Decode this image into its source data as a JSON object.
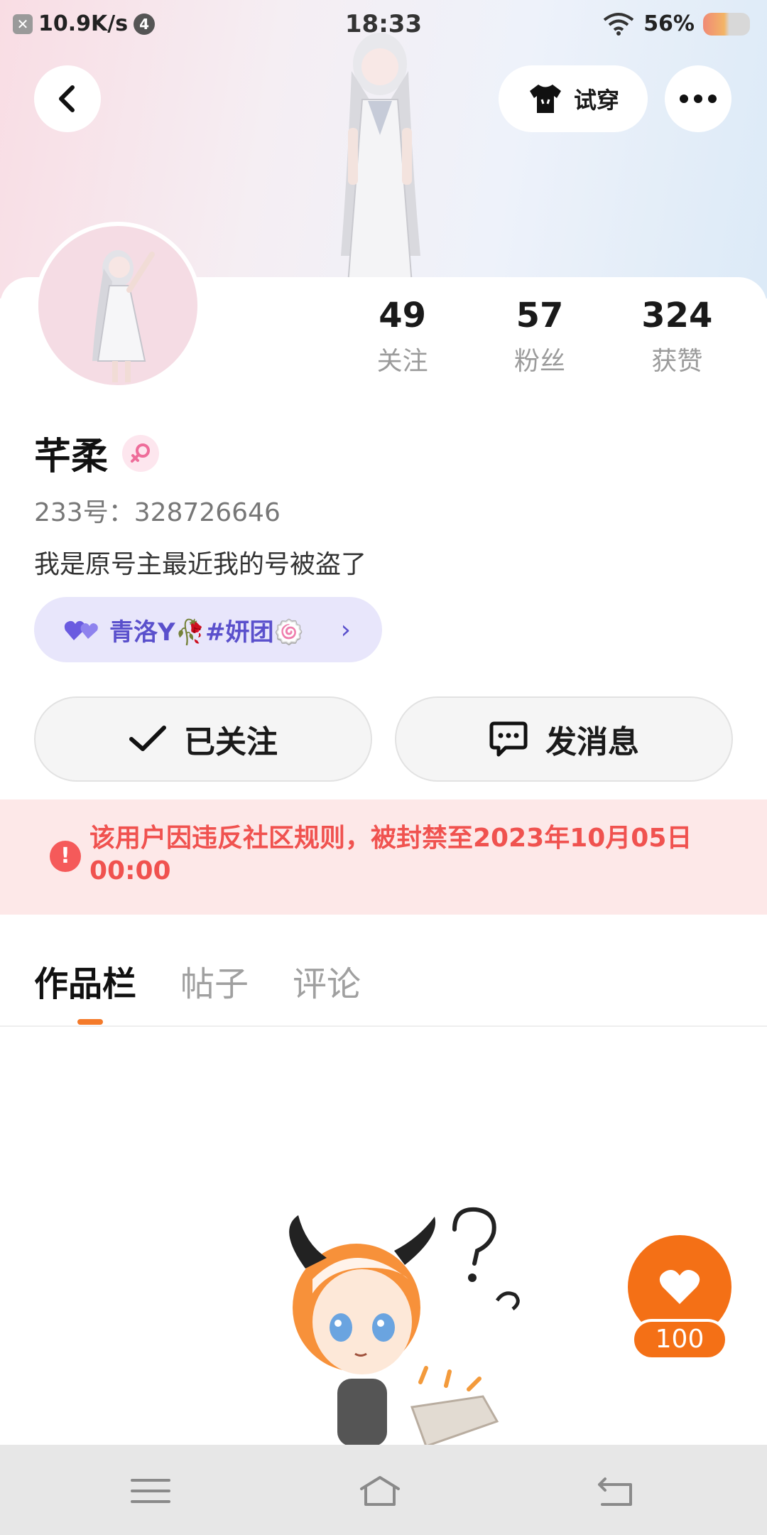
{
  "status_bar": {
    "speed": "10.9K/s",
    "badge": "4",
    "time": "18:33",
    "battery": "56%"
  },
  "header": {
    "tryon_label": "试穿"
  },
  "profile": {
    "name": "芊柔",
    "uid_text": "233号：328726646",
    "bio": "我是原号主最近我的号被盗了",
    "stats": [
      {
        "value": "49",
        "label": "关注"
      },
      {
        "value": "57",
        "label": "粉丝"
      },
      {
        "value": "324",
        "label": "获赞"
      }
    ],
    "group_label": "青洛Y🥀#妍团🍥"
  },
  "actions": {
    "follow_label": "已关注",
    "message_label": "发消息"
  },
  "ban_notice": "该用户因违反社区规则，被封禁至2023年10月05日 00:00",
  "tabs": [
    "作品栏",
    "帖子",
    "评论"
  ],
  "like_fab": {
    "count": "100"
  },
  "colors": {
    "accent_orange": "#f47016",
    "ban_red": "#f0524f",
    "group_purple": "#5a50cc"
  }
}
